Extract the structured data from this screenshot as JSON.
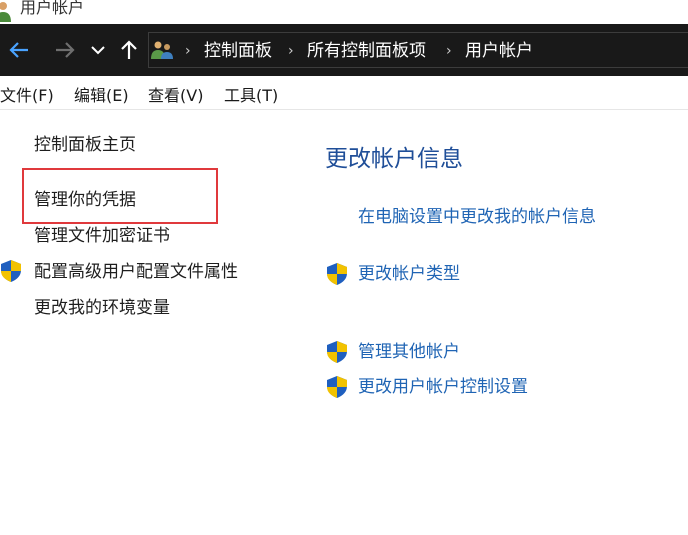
{
  "window": {
    "title": "用户帐户",
    "icon": "users-icon"
  },
  "address_bar": {
    "buttons": [
      {
        "name": "back",
        "icon": "arrow-left-icon"
      },
      {
        "name": "forward",
        "icon": "arrow-right-icon"
      },
      {
        "name": "recent",
        "icon": "chevron-down-icon"
      },
      {
        "name": "up",
        "icon": "arrow-up-icon"
      }
    ],
    "breadcrumbs": [
      "控制面板",
      "所有控制面板项",
      "用户帐户"
    ],
    "separator": "›"
  },
  "menubar": {
    "items": [
      "文件(F)",
      "编辑(E)",
      "查看(V)",
      "工具(T)"
    ]
  },
  "sidebar": {
    "links": [
      {
        "label": "控制面板主页",
        "shield": false
      },
      {
        "label": "管理你的凭据",
        "shield": false,
        "highlighted": true
      },
      {
        "label": "管理文件加密证书",
        "shield": false
      },
      {
        "label": "配置高级用户配置文件属性",
        "shield": true
      },
      {
        "label": "更改我的环境变量",
        "shield": false
      }
    ]
  },
  "main": {
    "heading": "更改帐户信息",
    "links": [
      {
        "label": "在电脑设置中更改我的帐户信息",
        "shield": false
      },
      {
        "label": "更改帐户类型",
        "shield": true
      },
      {
        "label": "管理其他帐户",
        "shield": true
      },
      {
        "label": "更改用户帐户控制设置",
        "shield": true
      }
    ]
  },
  "colors": {
    "address_bar_bg": "#191919",
    "heading": "#1f4e98",
    "link": "#1f64b4",
    "highlight_border": "#e0393c"
  }
}
